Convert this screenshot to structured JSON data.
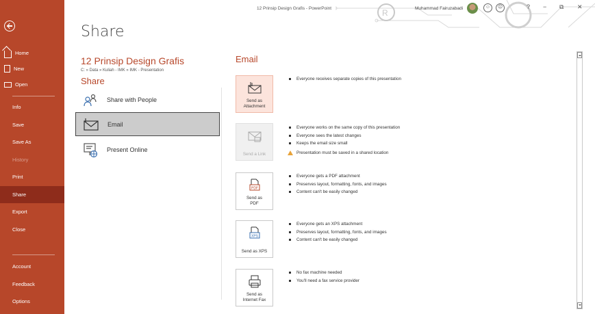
{
  "window": {
    "title": "12 Prinsip Design Grafis  -  PowerPoint",
    "user_name": "Muhammad Fairuzabadi",
    "smiley": "☺",
    "frown": "☹",
    "help": "?",
    "minimize": "−",
    "restore": "⧉",
    "close": "✕"
  },
  "sidebar": {
    "top_items": [
      {
        "label": "Home",
        "icon": "home-icon"
      },
      {
        "label": "New",
        "icon": "new-document-icon"
      },
      {
        "label": "Open",
        "icon": "folder-open-icon"
      }
    ],
    "main_items": [
      {
        "label": "Info"
      },
      {
        "label": "Save"
      },
      {
        "label": "Save As"
      },
      {
        "label": "History",
        "disabled": true
      },
      {
        "label": "Print"
      },
      {
        "label": "Share",
        "active": true
      },
      {
        "label": "Export"
      },
      {
        "label": "Close"
      }
    ],
    "bottom_items": [
      {
        "label": "Account"
      },
      {
        "label": "Feedback"
      },
      {
        "label": "Options"
      }
    ],
    "accent_color": "#b7472a",
    "active_color": "#8e2c1b"
  },
  "header": {
    "page_title": "Share",
    "doc_title": "12 Prinsip Design Grafis",
    "doc_path": "C: » Data » Kuliah - IMK » IMK - Presentation",
    "section_title": "Share"
  },
  "share_options": [
    {
      "label": "Share with People",
      "icon": "share-people-icon"
    },
    {
      "label": "Email",
      "icon": "email-icon",
      "selected": true
    },
    {
      "label": "Present Online",
      "icon": "present-online-icon"
    }
  ],
  "email": {
    "heading": "Email",
    "actions": [
      {
        "label": "Send as\nAttachment",
        "icon": "email-attachment-icon",
        "highlight": true,
        "bullets": [
          "Everyone receives separate copies of this presentation"
        ]
      },
      {
        "label": "Send a Link",
        "icon": "send-link-icon",
        "disabled": true,
        "bullets": [
          "Everyone works on the same copy of this presentation",
          "Everyone sees the latest changes",
          "Keeps the email size small"
        ],
        "warning": "Presentation must be saved in a shared location"
      },
      {
        "label": "Send as\nPDF",
        "icon": "pdf-icon",
        "bullets": [
          "Everyone gets a PDF attachment",
          "Preserves layout, formatting, fonts, and images",
          "Content can't be easily changed"
        ]
      },
      {
        "label": "Send as XPS",
        "icon": "xps-icon",
        "bullets": [
          "Everyone gets an XPS attachment",
          "Preserves layout, formatting, fonts, and images",
          "Content can't be easily changed"
        ]
      },
      {
        "label": "Send as\nInternet Fax",
        "icon": "fax-icon",
        "bullets": [
          "No fax machine needed",
          "You'll need a fax service provider"
        ]
      }
    ]
  },
  "pdf_badge": "PDF",
  "xps_badge": "XPS"
}
